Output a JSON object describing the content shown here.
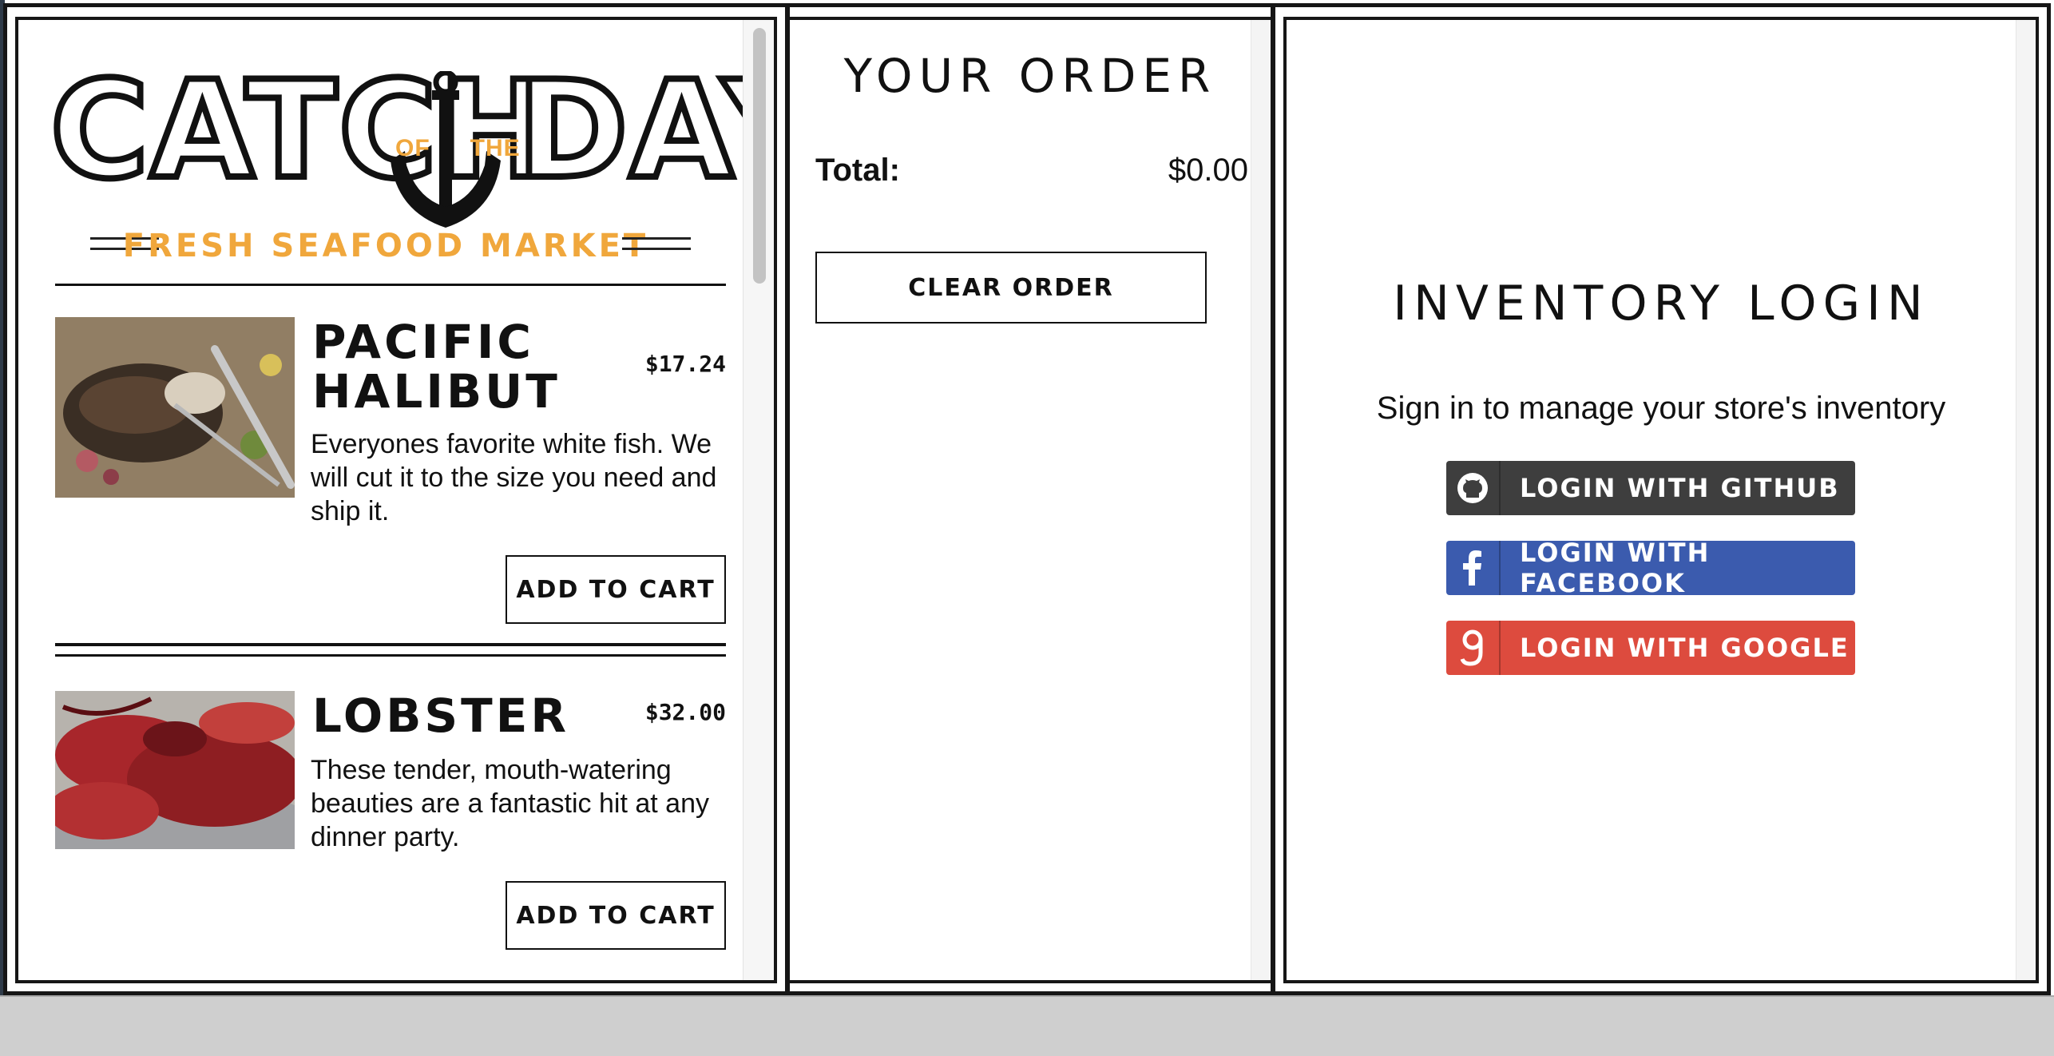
{
  "menu": {
    "logo": {
      "word_left": "CATCH",
      "word_right": "DAY",
      "of": "OF",
      "the": "THE",
      "tagline": "FRESH SEAFOOD MARKET",
      "accent_color": "#f0a73c"
    },
    "fishes": [
      {
        "name": "PACIFIC HALIBUT",
        "price": "$17.24",
        "description": "Everyones favorite white fish. We will cut it to the size you need and ship it.",
        "button": "ADD TO CART"
      },
      {
        "name": "LOBSTER",
        "price": "$32.00",
        "description": "These tender, mouth-watering beauties are a fantastic hit at any dinner party.",
        "button": "ADD TO CART"
      }
    ]
  },
  "order": {
    "title": "YOUR ORDER",
    "total_label": "Total:",
    "total_value": "$0.00",
    "clear_button": "CLEAR ORDER"
  },
  "inventory": {
    "title": "INVENTORY LOGIN",
    "subtitle": "Sign in to manage your store's inventory",
    "buttons": [
      {
        "label": "LOGIN WITH GITHUB",
        "icon": "github-icon",
        "color": "#3e3e3e"
      },
      {
        "label": "LOGIN WITH FACEBOOK",
        "icon": "facebook-icon",
        "color": "#3b5bae"
      },
      {
        "label": "LOGIN WITH GOOGLE",
        "icon": "google-icon",
        "color": "#dd4b3e"
      }
    ]
  }
}
